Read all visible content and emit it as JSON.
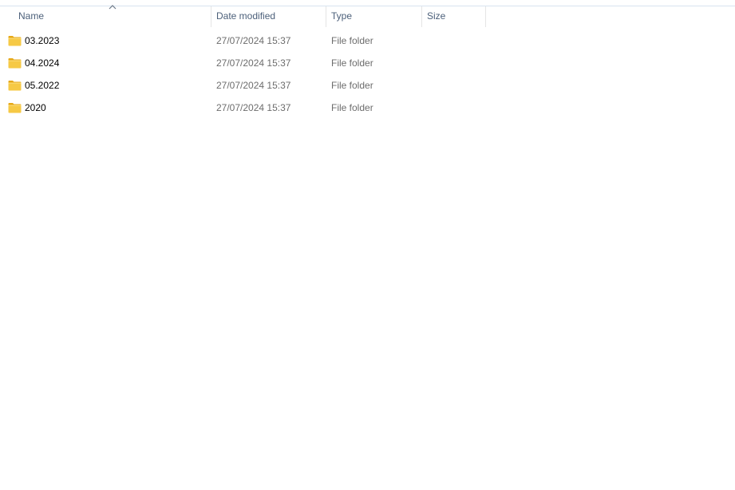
{
  "columns": {
    "name": "Name",
    "date_modified": "Date modified",
    "type": "Type",
    "size": "Size"
  },
  "sort": {
    "column": "name",
    "icon": "chevron-up-icon"
  },
  "rows": [
    {
      "icon": "folder-icon",
      "name": "03.2023",
      "date_modified": "27/07/2024 15:37",
      "type": "File folder",
      "size": ""
    },
    {
      "icon": "folder-icon",
      "name": "04.2024",
      "date_modified": "27/07/2024 15:37",
      "type": "File folder",
      "size": ""
    },
    {
      "icon": "folder-icon",
      "name": "05.2022",
      "date_modified": "27/07/2024 15:37",
      "type": "File folder",
      "size": ""
    },
    {
      "icon": "folder-icon",
      "name": "2020",
      "date_modified": "27/07/2024 15:37",
      "type": "File folder",
      "size": ""
    }
  ],
  "colors": {
    "header_text": "#4c607a",
    "folder_yellow": "#f6c945",
    "folder_dark": "#e6a817"
  }
}
